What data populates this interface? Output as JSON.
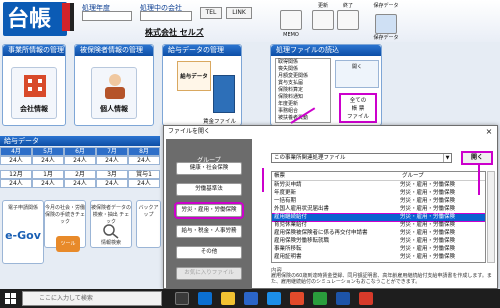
{
  "header": {
    "logo_text": "台帳",
    "label_year": "処理年度",
    "label_company": "処理中の会社",
    "tel_button": "TEL",
    "link_button": "LINK",
    "company_name": "株式会社 セルズ",
    "icon_memo": "MEMO",
    "icon_update": "更新",
    "icon_end": "終了",
    "icon_save": "保存データ",
    "save_sub": "保存データ"
  },
  "panels": {
    "company": {
      "title": "事業所情報の管理",
      "button": "会社情報"
    },
    "person": {
      "title": "被保険者情報の管理",
      "button": "個人情報"
    },
    "kyuyo": {
      "title": "給与データの管理",
      "book": "給与データ",
      "file": "賃金ファイル"
    },
    "files": {
      "title": "処理ファイルの読込",
      "items": [
        "取得関係",
        "喪失関係",
        "月額変更関係",
        "賞与支払届",
        "保険料算定",
        "保険料通知",
        "年度更新",
        "事務組合",
        "被扶養者異動"
      ],
      "button_line1": "全ての",
      "button_line2": "帳 票",
      "button_line3": "ファイル",
      "open_label": "開く"
    }
  },
  "kyuyo_grid": {
    "bar_label": "給与データ",
    "months_top": [
      "4月",
      "5月",
      "6月",
      "7月",
      "8月"
    ],
    "counts_top": [
      "24人",
      "24人",
      "24人",
      "24人",
      "24人"
    ],
    "months_bottom": [
      "12月",
      "1月",
      "2月",
      "3月",
      "賞与1"
    ],
    "counts_bottom": [
      "24人",
      "24人",
      "24人",
      "24人",
      "24人"
    ]
  },
  "tiles": [
    {
      "label": "電子申請関係"
    },
    {
      "label": "今月の社会・労働保険の手続きチェック"
    },
    {
      "label": "被保険者データの検索・抽出 チェック"
    },
    {
      "label": "バックアップ"
    }
  ],
  "tile_texts": {
    "egov": "e-Gov",
    "tool": "ツール",
    "search": "情報検索",
    "backup": "バックアップ"
  },
  "dialog": {
    "title": "ファイルを開く",
    "close": "×",
    "group_heading": "グループ",
    "group_buttons": [
      "健康・社会保険",
      "労働基準法",
      "労災・雇用・労働保険",
      "給与・税金・人事労務",
      "その他",
      "お気に入りファイル"
    ],
    "file_select": "この事業所関連処理ファイル",
    "open_button": "開く",
    "list_header_name": "帳票",
    "list_header_group": "グループ",
    "rows": [
      {
        "name": "新労災申請",
        "group": "労災・雇用・労働保険"
      },
      {
        "name": "年度更新",
        "group": "労災・雇用・労働保険"
      },
      {
        "name": "一括有期",
        "group": "労災・雇用・労働保険"
      },
      {
        "name": "外国人雇用状況届出書",
        "group": "労災・雇用・労働保険"
      },
      {
        "name": "雇用継続給付",
        "group": "労災・雇用・労働保険"
      },
      {
        "name": "育児休業給付",
        "group": "労災・雇用・労働保険"
      },
      {
        "name": "雇用保険被保険者に係る再交付申請書",
        "group": "労災・雇用・労働保険"
      },
      {
        "name": "雇用保険労働移転就職",
        "group": "労災・雇用・労働保険"
      },
      {
        "name": "事業所移転",
        "group": "労災・雇用・労働保険"
      },
      {
        "name": "雇用証明書",
        "group": "労災・雇用・労働保険"
      }
    ],
    "selected_index": 4,
    "description_label": "内容",
    "description": "雇用保険の60歳到達時賃金登録、同月額証明書、高年齢雇用継続給付支給申請書を作成します。また、雇用継続給付のシミュレーションもおこなうことができます。"
  },
  "taskbar": {
    "search_placeholder": "ここに入力して検索"
  },
  "colors": {
    "accent_blue": "#0d4ea6",
    "highlight_magenta": "#cc00cc",
    "selection_blue": "#0a62d0"
  }
}
